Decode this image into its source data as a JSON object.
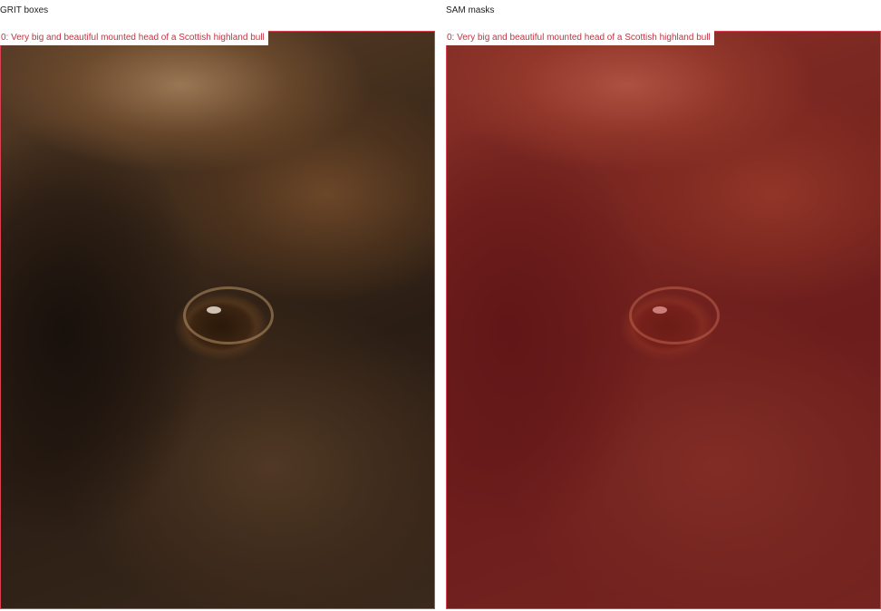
{
  "panels": {
    "left": {
      "title": "GRIT boxes",
      "box_label": "0: Very big and beautiful mounted head of a Scottish highland bull"
    },
    "right": {
      "title": "SAM masks",
      "box_label": "0: Very big and beautiful mounted head of a Scottish highland bull"
    }
  },
  "colors": {
    "box_outline": "#d94150",
    "label_text": "#c73040",
    "mask_tint": "#c81e28"
  }
}
